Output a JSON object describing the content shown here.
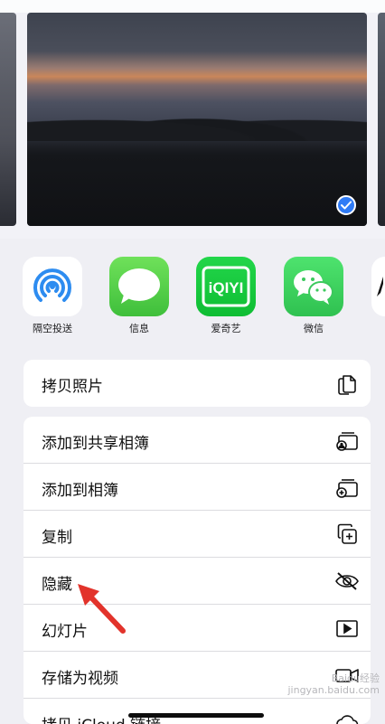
{
  "colors": {
    "accent": "#2f7bf6",
    "arrow": "#e2332b",
    "background": "#efeff4"
  },
  "apps": [
    {
      "name": "airdrop",
      "label": "隔空投送",
      "icon": "airdrop-icon"
    },
    {
      "name": "messages",
      "label": "信息",
      "icon": "messages-icon"
    },
    {
      "name": "iqiyi",
      "label": "爱奇艺",
      "icon": "iqiyi-icon",
      "logo_text": "iQIYI"
    },
    {
      "name": "wechat",
      "label": "微信",
      "icon": "wechat-icon"
    }
  ],
  "actions_primary": [
    {
      "label": "拷贝照片",
      "icon": "copy-photo-icon"
    }
  ],
  "actions_secondary": [
    {
      "label": "添加到共享相簿",
      "icon": "shared-album-icon"
    },
    {
      "label": "添加到相簿",
      "icon": "add-album-icon"
    },
    {
      "label": "复制",
      "icon": "duplicate-icon"
    },
    {
      "label": "隐藏",
      "icon": "eye-slash-icon"
    },
    {
      "label": "幻灯片",
      "icon": "slideshow-icon"
    },
    {
      "label": "存储为视频",
      "icon": "video-icon"
    },
    {
      "label": "拷贝 iCloud 链接",
      "icon": "cloud-link-icon"
    }
  ],
  "watermark": {
    "line1": "Baidu经验",
    "line2": "jingyan.baidu.com"
  }
}
